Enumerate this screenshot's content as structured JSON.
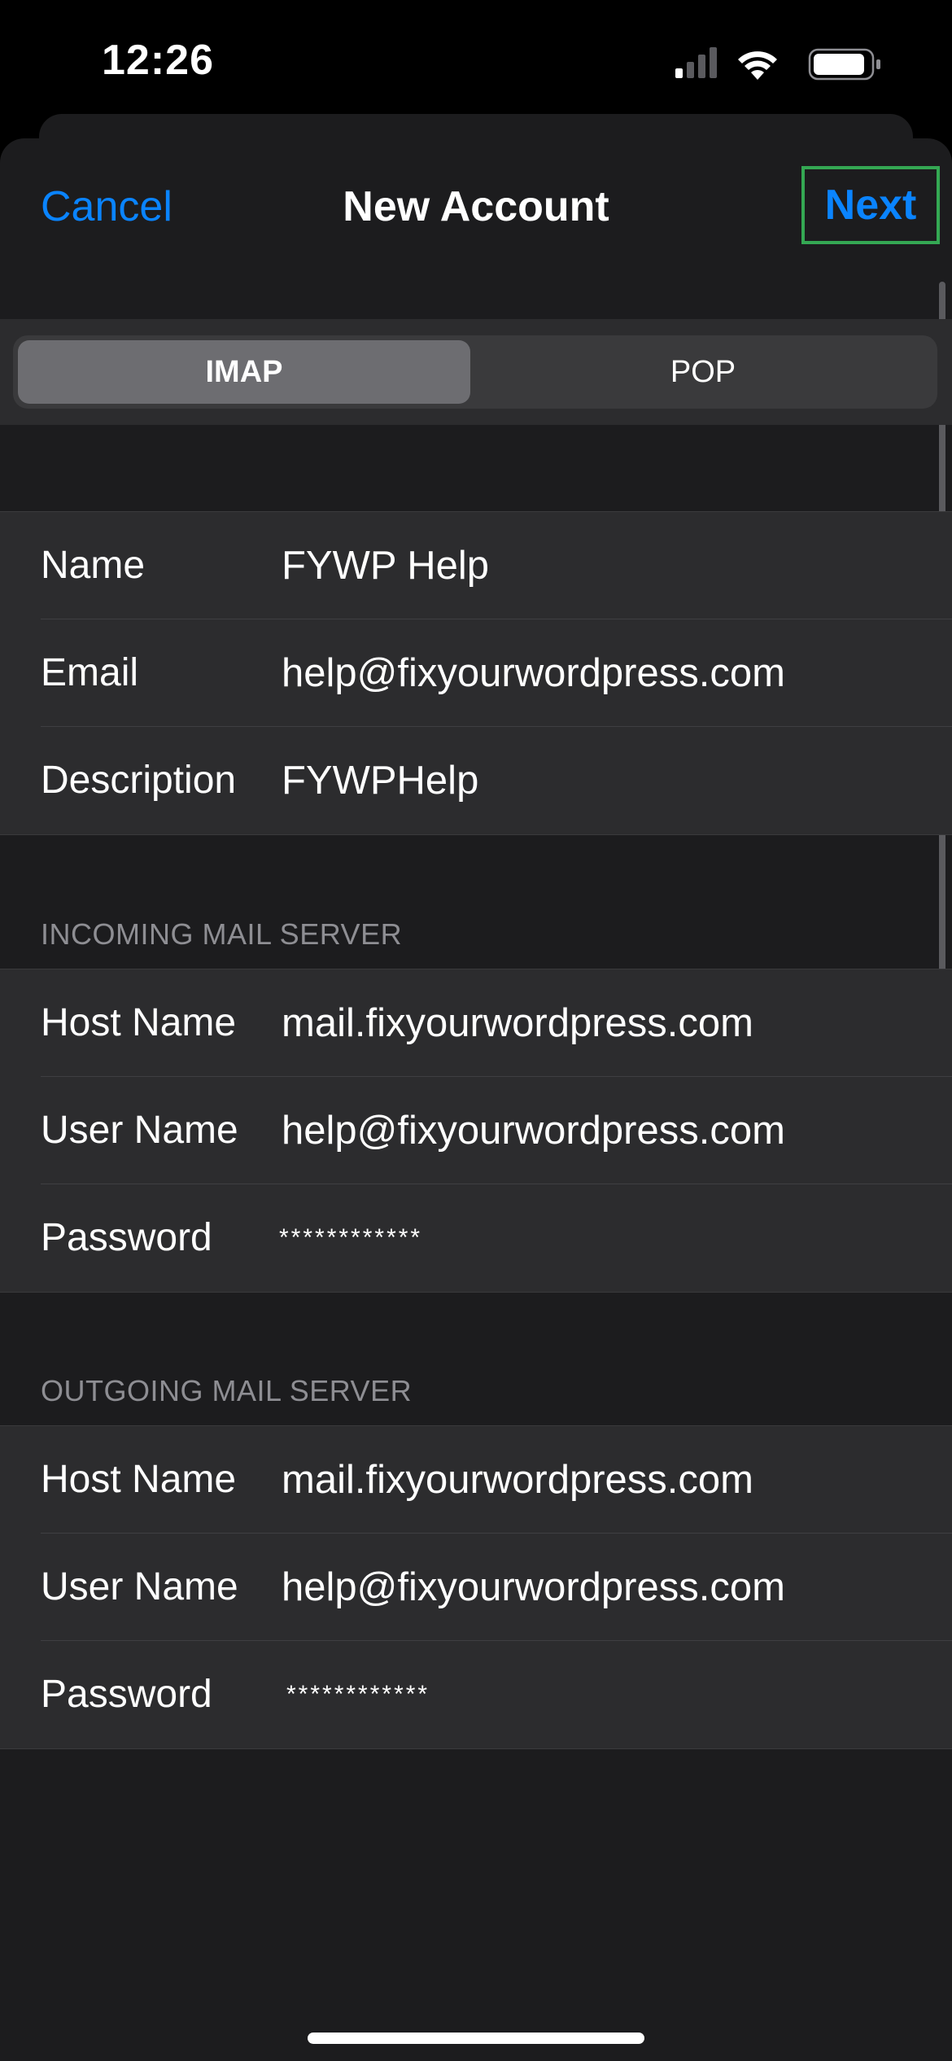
{
  "status_bar": {
    "time": "12:26",
    "icons": [
      "cellular-signal-icon",
      "wifi-icon",
      "battery-icon"
    ]
  },
  "nav": {
    "cancel_label": "Cancel",
    "title": "New Account",
    "next_label": "Next"
  },
  "segmented": {
    "options": [
      "IMAP",
      "POP"
    ],
    "selected": "IMAP"
  },
  "account": {
    "name_label": "Name",
    "name_value": "FYWP Help",
    "email_label": "Email",
    "email_value": "help@fixyourwordpress.com",
    "description_label": "Description",
    "description_value": "FYWPHelp"
  },
  "incoming": {
    "header": "INCOMING MAIL SERVER",
    "host_label": "Host Name",
    "host_value": "mail.fixyourwordpress.com",
    "user_label": "User Name",
    "user_value": "help@fixyourwordpress.com",
    "password_label": "Password",
    "password_value": "************"
  },
  "outgoing": {
    "header": "OUTGOING MAIL SERVER",
    "host_label": "Host Name",
    "host_value": "mail.fixyourwordpress.com",
    "user_label": "User Name",
    "user_value": "help@fixyourwordpress.com",
    "password_label": "Password",
    "password_value": "************"
  },
  "colors": {
    "accent": "#0a84ff",
    "highlight_outline": "#34a853",
    "background": "#1c1c1e",
    "cell": "#2c2c2e",
    "secondary_text": "#8e8e93"
  }
}
